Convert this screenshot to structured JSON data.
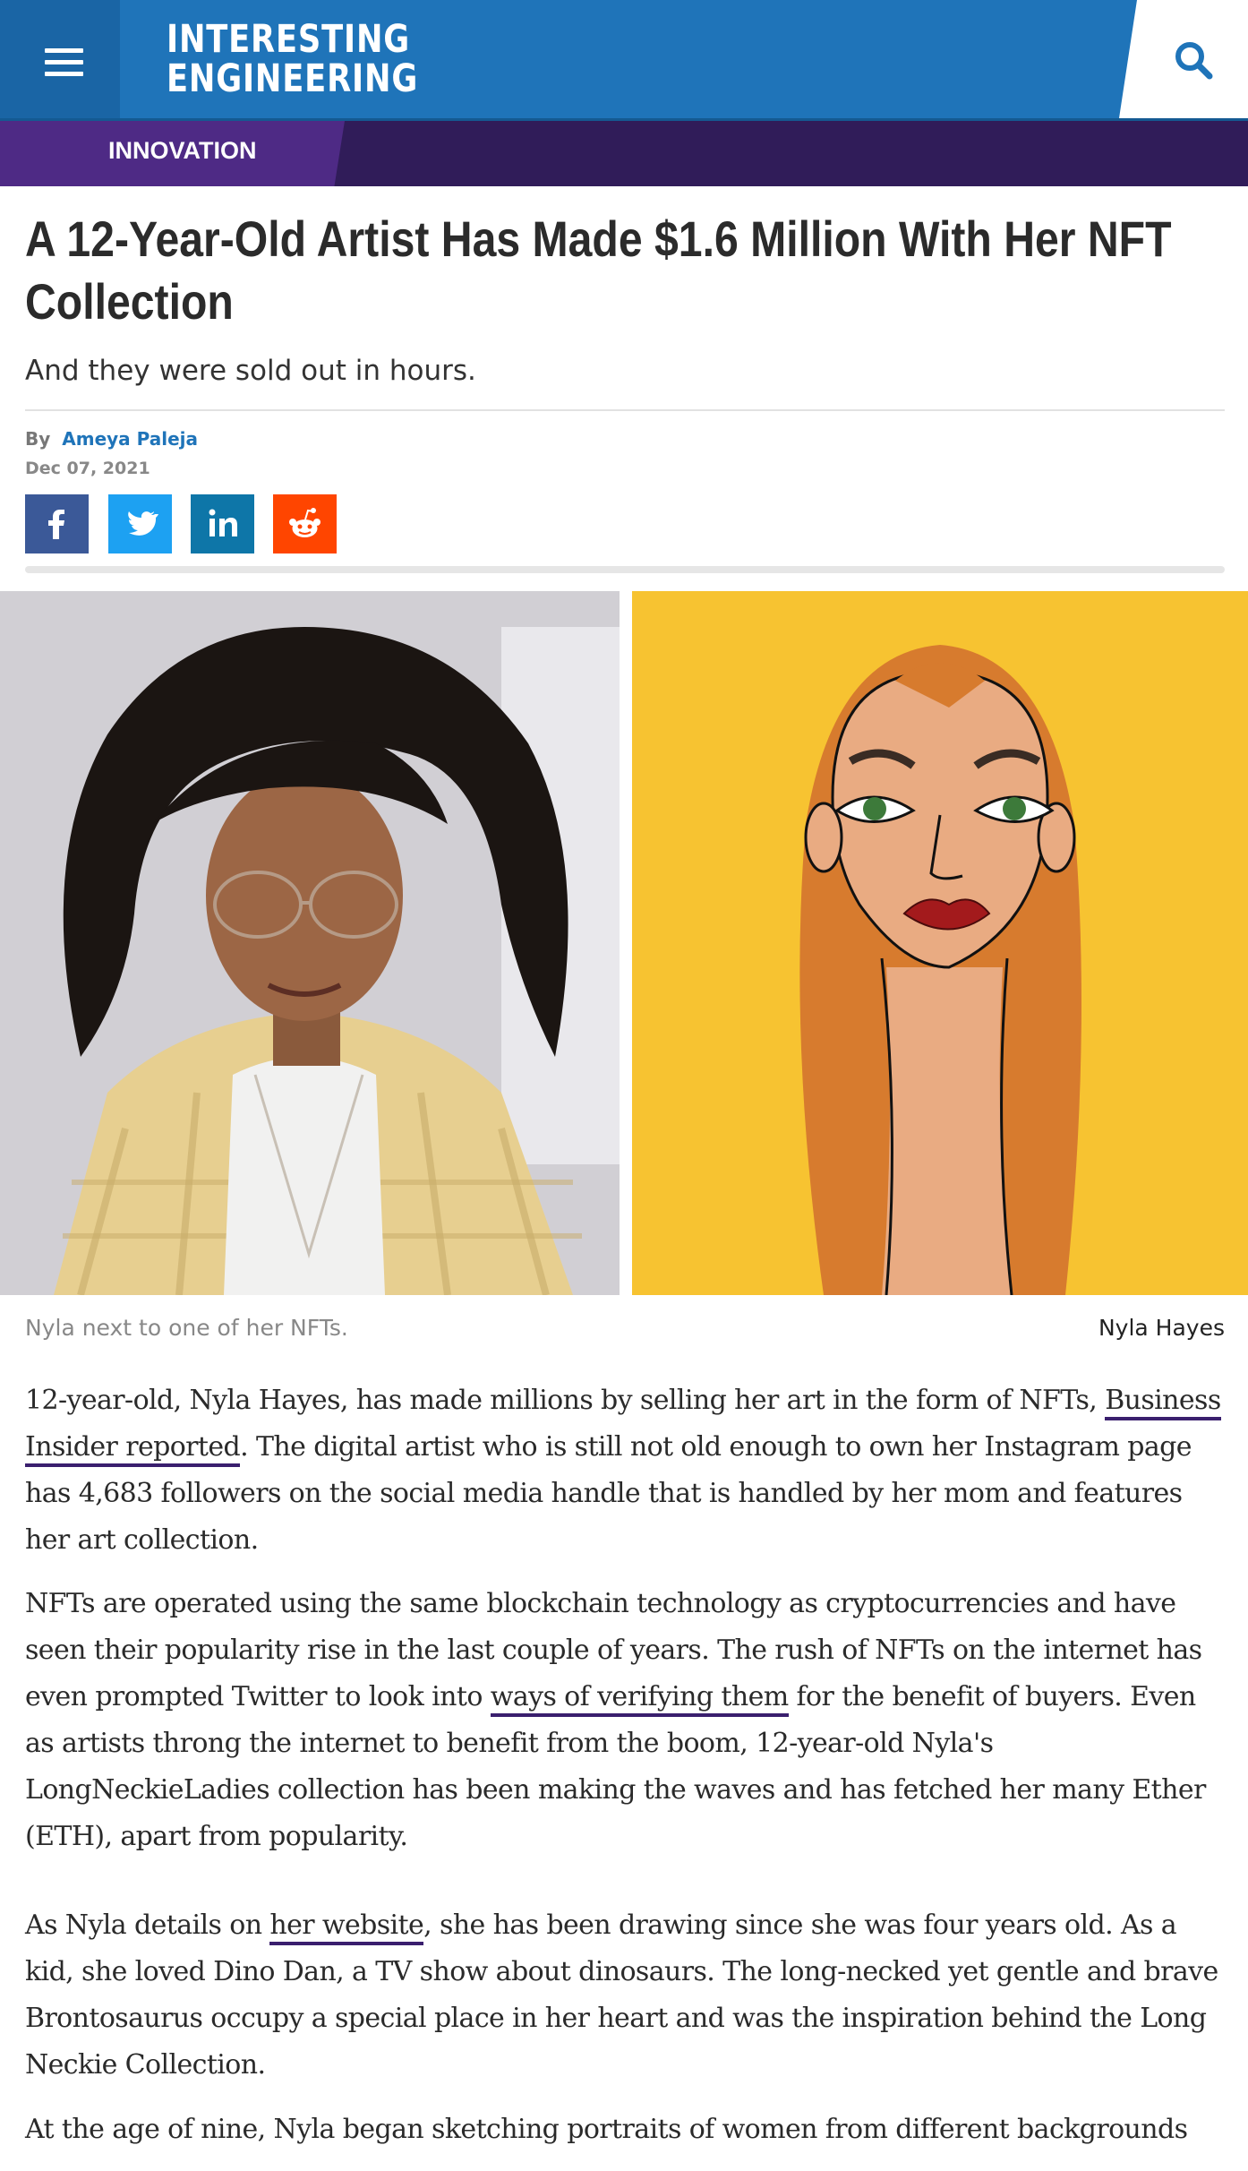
{
  "header": {
    "logo_line1": "INTERESTING",
    "logo_line2": "ENGINEERING",
    "menu_icon": "hamburger-icon",
    "search_icon": "search-icon",
    "brand_color": "#1f74b9",
    "section_color": "#301c59"
  },
  "section": {
    "label": "INNOVATION"
  },
  "article": {
    "title": "A 12-Year-Old Artist Has Made $1.6 Million With Her NFT Collection",
    "subtitle": "And they were sold out in hours.",
    "by_label": "By",
    "author": "Ameya Paleja",
    "date": "Dec 07, 2021",
    "share": [
      {
        "network": "facebook",
        "icon": "facebook-icon",
        "color": "#3b5998"
      },
      {
        "network": "twitter",
        "icon": "twitter-icon",
        "color": "#1da1f2"
      },
      {
        "network": "linkedin",
        "icon": "linkedin-icon",
        "color": "#0e76a8"
      },
      {
        "network": "reddit",
        "icon": "reddit-icon",
        "color": "#ff4500"
      }
    ],
    "image": {
      "caption": "Nyla next to one of her NFTs.",
      "credit": "Nyla Hayes"
    },
    "paragraphs": {
      "p1": {
        "pre": "12-year-old, Nyla Hayes, has made millions by selling her art in the form of NFTs, ",
        "link": "Business Insider reported",
        "post": ". The digital artist who is still not old enough to own her Instagram page has 4,683 followers on the social media handle that is handled by her mom and features her art collection."
      },
      "p2": {
        "pre": "NFTs are operated using the same blockchain technology as cryptocurrencies and have seen their popularity rise in the last couple of years. The rush of NFTs on the internet has even prompted Twitter to look into ",
        "link": "ways of verifying them",
        "post": " for the benefit of buyers. Even as artists throng the internet to benefit from the boom, 12-year-old Nyla's LongNeckieLadies collection has been making the waves and has fetched her many Ether (ETH), apart from popularity."
      },
      "p3": {
        "pre": "As Nyla details on ",
        "link": "her website",
        "post": ", she has been drawing since she was four years old. As a kid, she loved Dino Dan, a TV show about dinosaurs. The long-necked yet gentle and brave Brontosaurus occupy a special place in her heart and was the inspiration behind the Long Neckie Collection."
      },
      "p4": {
        "text": "At the age of nine, Nyla began sketching portraits of women from different backgrounds"
      }
    }
  }
}
